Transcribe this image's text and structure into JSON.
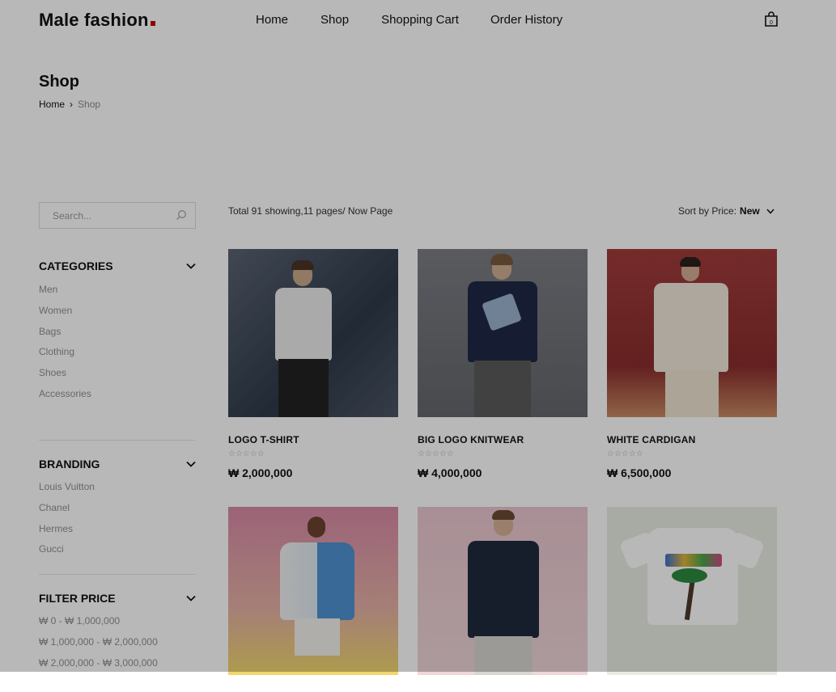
{
  "header": {
    "logo_text": "Male fashion",
    "nav": [
      "Home",
      "Shop",
      "Shopping Cart",
      "Order History"
    ],
    "cart_icon": "shopping-bag-icon"
  },
  "page": {
    "title": "Shop",
    "breadcrumb": {
      "home": "Home",
      "current": "Shop"
    }
  },
  "sidebar": {
    "search_placeholder": "Search...",
    "categories": {
      "title": "CATEGORIES",
      "items": [
        "Men",
        "Women",
        "Bags",
        "Clothing",
        "Shoes",
        "Accessories"
      ]
    },
    "branding": {
      "title": "BRANDING",
      "items": [
        "Louis Vuitton",
        "Chanel",
        "Hermes",
        "Gucci"
      ]
    },
    "filter_price": {
      "title": "FILTER PRICE",
      "items": [
        "₩ 0 - ₩ 1,000,000",
        "₩ 1,000,000 - ₩ 2,000,000",
        "₩ 2,000,000 - ₩ 3,000,000"
      ]
    }
  },
  "toolbar": {
    "summary": "Total 91 showing,11 pages/ Now Page",
    "sort_label": "Sort by Price:",
    "sort_value": "New"
  },
  "products": [
    {
      "name": "LOGO T-SHIRT",
      "price": "₩ 2,000,000",
      "bg": "#4a5566",
      "accent": "#f2f2f2"
    },
    {
      "name": "BIG LOGO KNITWEAR",
      "price": "₩ 4,000,000",
      "bg": "#6f7177",
      "accent": "#1d2540"
    },
    {
      "name": "WHITE CARDIGAN",
      "price": "₩ 6,500,000",
      "bg": "#9b3b3b",
      "accent": "#efe8dc"
    },
    {
      "name": "",
      "price": "",
      "bg": "#d78aa6",
      "accent": "#4d8fd0"
    },
    {
      "name": "",
      "price": "",
      "bg": "#e7c8cf",
      "accent": "#1f2a3d"
    },
    {
      "name": "",
      "price": "",
      "bg": "#e6eadf",
      "accent": "#ffffff"
    }
  ],
  "colors": {
    "brand_dot": "#c70000",
    "muted_text": "#8f8f8f"
  }
}
